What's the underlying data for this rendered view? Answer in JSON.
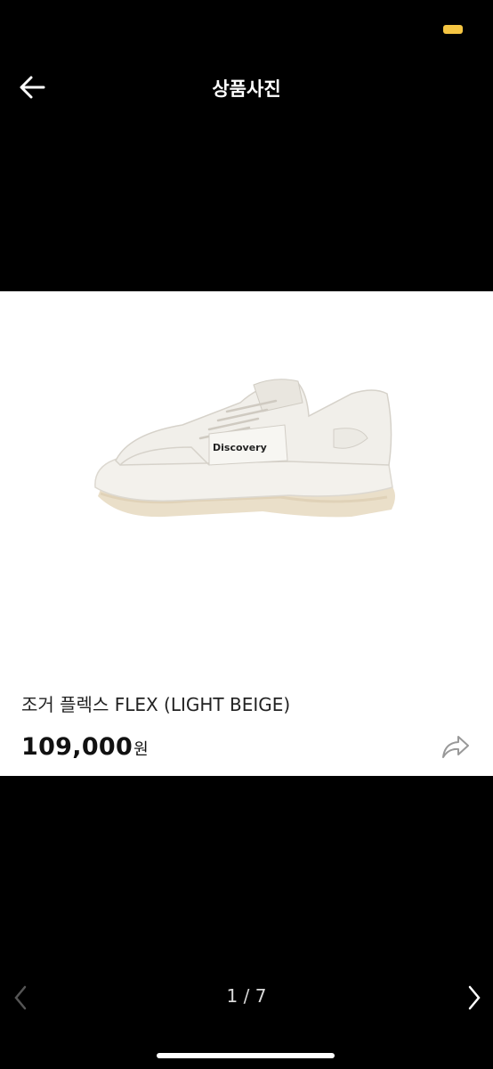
{
  "status_bar": {
    "battery_color": "#f5c542"
  },
  "header": {
    "title": "상품사진",
    "back_icon": "arrow-left-icon"
  },
  "product": {
    "image_alt": "shoe-image",
    "brand_text_on_image": "Discovery",
    "name": "조거 플렉스 FLEX (LIGHT BEIGE)",
    "price": "109,000",
    "price_unit": "원",
    "share_icon": "share-arrow-icon"
  },
  "pager": {
    "text": "1 / 7",
    "prev_icon": "chevron-left-icon",
    "next_icon": "chevron-right-icon"
  }
}
